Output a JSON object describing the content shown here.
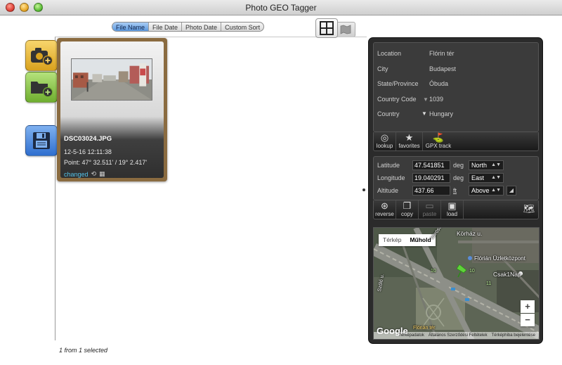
{
  "window": {
    "title": "Photo GEO Tagger"
  },
  "sort": {
    "options": [
      "File Name",
      "File Date",
      "Photo Date",
      "Custom Sort"
    ],
    "active": 0
  },
  "icons": {
    "grid_view": "grid-icon",
    "map_view": "map-icon",
    "add_photo": "camera-plus-icon",
    "add_folder": "folder-plus-icon",
    "save": "floppy-disk-icon"
  },
  "photo": {
    "filename": "DSC03024.JPG",
    "date": "12-5-16 12:11:38",
    "point": "Point: 47° 32.511' / 19° 2.417'",
    "status": "changed"
  },
  "status_bar": {
    "selection": "1 from 1 selected"
  },
  "location": {
    "location_label": "Location",
    "location_value": "Flórin tér",
    "city_label": "City",
    "city_value": "Budapest",
    "state_label": "State/Province",
    "state_value": "Óbuda",
    "country_code_label": "Country Code",
    "country_code_value": "1039",
    "country_label": "Country",
    "country_value": "Hungary"
  },
  "location_tools": {
    "lookup": "lookup",
    "favorites": "favorites",
    "gpx": "GPX track"
  },
  "coords": {
    "lat_label": "Latitude",
    "lat_value": "47.541851",
    "lat_unit": "deg",
    "lat_dir": "North",
    "lon_label": "Longitude",
    "lon_value": "19.040291",
    "lon_unit": "deg",
    "lon_dir": "East",
    "alt_label": "Altitude",
    "alt_value": "437.66",
    "alt_unit": "ft",
    "alt_ref": "Above"
  },
  "coord_tools": {
    "reverse": "reverse",
    "copy": "copy",
    "paste": "paste",
    "load": "load"
  },
  "map": {
    "tab_map": "Térkép",
    "tab_sat": "Műhold",
    "street1": "Körház u.",
    "street2": "Vörösvári út",
    "street3": "Szőlő u.",
    "poi1": "Flórián Üzletközpont",
    "poi2": "Csak1Nap",
    "square": "Flórián tér",
    "road_num1": "10",
    "road_num2": "10",
    "road_num3": "11",
    "zoom_in": "+",
    "zoom_out": "−",
    "logo": "Google",
    "footer": [
      "Térképadatok",
      "Általános Szerződési Feltételek",
      "Térképhiba bejelentése"
    ]
  }
}
